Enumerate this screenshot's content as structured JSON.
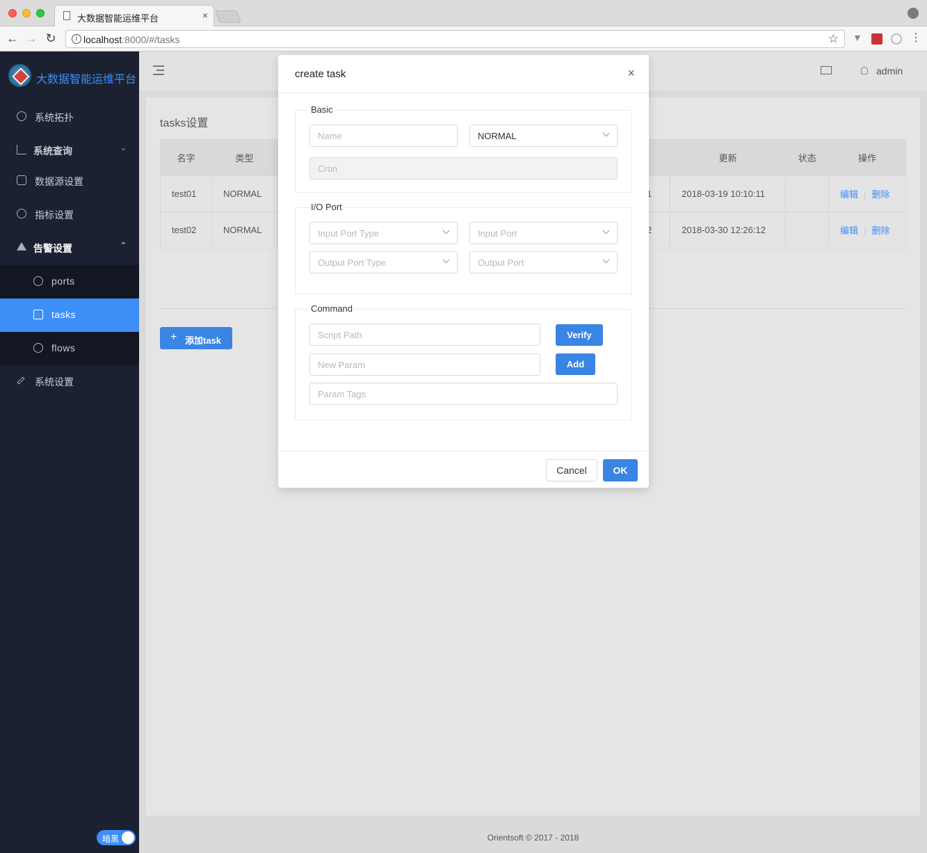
{
  "browser": {
    "tab_title": "大数据智能运维平台",
    "tab_close": "×",
    "url_host": "localhost",
    "url_rest": ":8000/#/tasks",
    "info_glyph": "i",
    "star_glyph": "☆",
    "menu_glyph": "⋮"
  },
  "nav": {
    "back": "←",
    "forward": "→",
    "reload": "↻"
  },
  "sidebar": {
    "brand": "大数据智能运维平台",
    "items": [
      {
        "label": "系统拓扑",
        "icon": "dashboard-icon"
      },
      {
        "label": "系统查询",
        "icon": "bar-chart-icon",
        "caret": "⌄"
      },
      {
        "label": "数据源设置",
        "icon": "database-icon"
      },
      {
        "label": "指标设置",
        "icon": "settings-icon"
      },
      {
        "label": "告警设置",
        "icon": "warning-icon",
        "caret": "⌃"
      },
      {
        "label": "系统设置",
        "icon": "wrench-icon"
      }
    ],
    "sub_items": [
      {
        "label": "ports",
        "icon": "clock-icon"
      },
      {
        "label": "tasks",
        "icon": "list-icon"
      },
      {
        "label": "flows",
        "icon": "sync-icon"
      }
    ],
    "dark_toggle": "暗黑"
  },
  "header": {
    "user": "admin"
  },
  "page": {
    "title": "tasks设置",
    "table": {
      "headers": [
        "名字",
        "类型",
        "更新",
        "状态",
        "操作"
      ],
      "rows": [
        {
          "name": "test01",
          "type": "NORMAL",
          "partial": "1",
          "updated": "2018-03-19 10:10:11",
          "status": "",
          "edit": "编辑",
          "delete": "删除"
        },
        {
          "name": "test02",
          "type": "NORMAL",
          "partial": "2",
          "updated": "2018-03-30 12:26:12",
          "status": "",
          "edit": "编辑",
          "delete": "删除"
        }
      ]
    },
    "add_button": "添加task",
    "add_plus": "+"
  },
  "footer": "Orientsoft © 2017 - 2018",
  "modal": {
    "title": "create task",
    "close": "×",
    "basic": {
      "legend": "Basic",
      "name_placeholder": "Name",
      "type_value": "NORMAL",
      "cron_placeholder": "Cron"
    },
    "io": {
      "legend": "I/O Port",
      "input_type_placeholder": "Input Port Type",
      "input_port_placeholder": "Input Port",
      "output_type_placeholder": "Output Port Type",
      "output_port_placeholder": "Output Port"
    },
    "command": {
      "legend": "Command",
      "script_placeholder": "Script Path",
      "verify": "Verify",
      "param_placeholder": "New Param",
      "add": "Add",
      "tags_placeholder": "Param Tags"
    },
    "cancel": "Cancel",
    "ok": "OK"
  },
  "colors": {
    "accent": "#3a84e4",
    "sidebar": "#1b2130",
    "brand": "#3e8ef7"
  }
}
